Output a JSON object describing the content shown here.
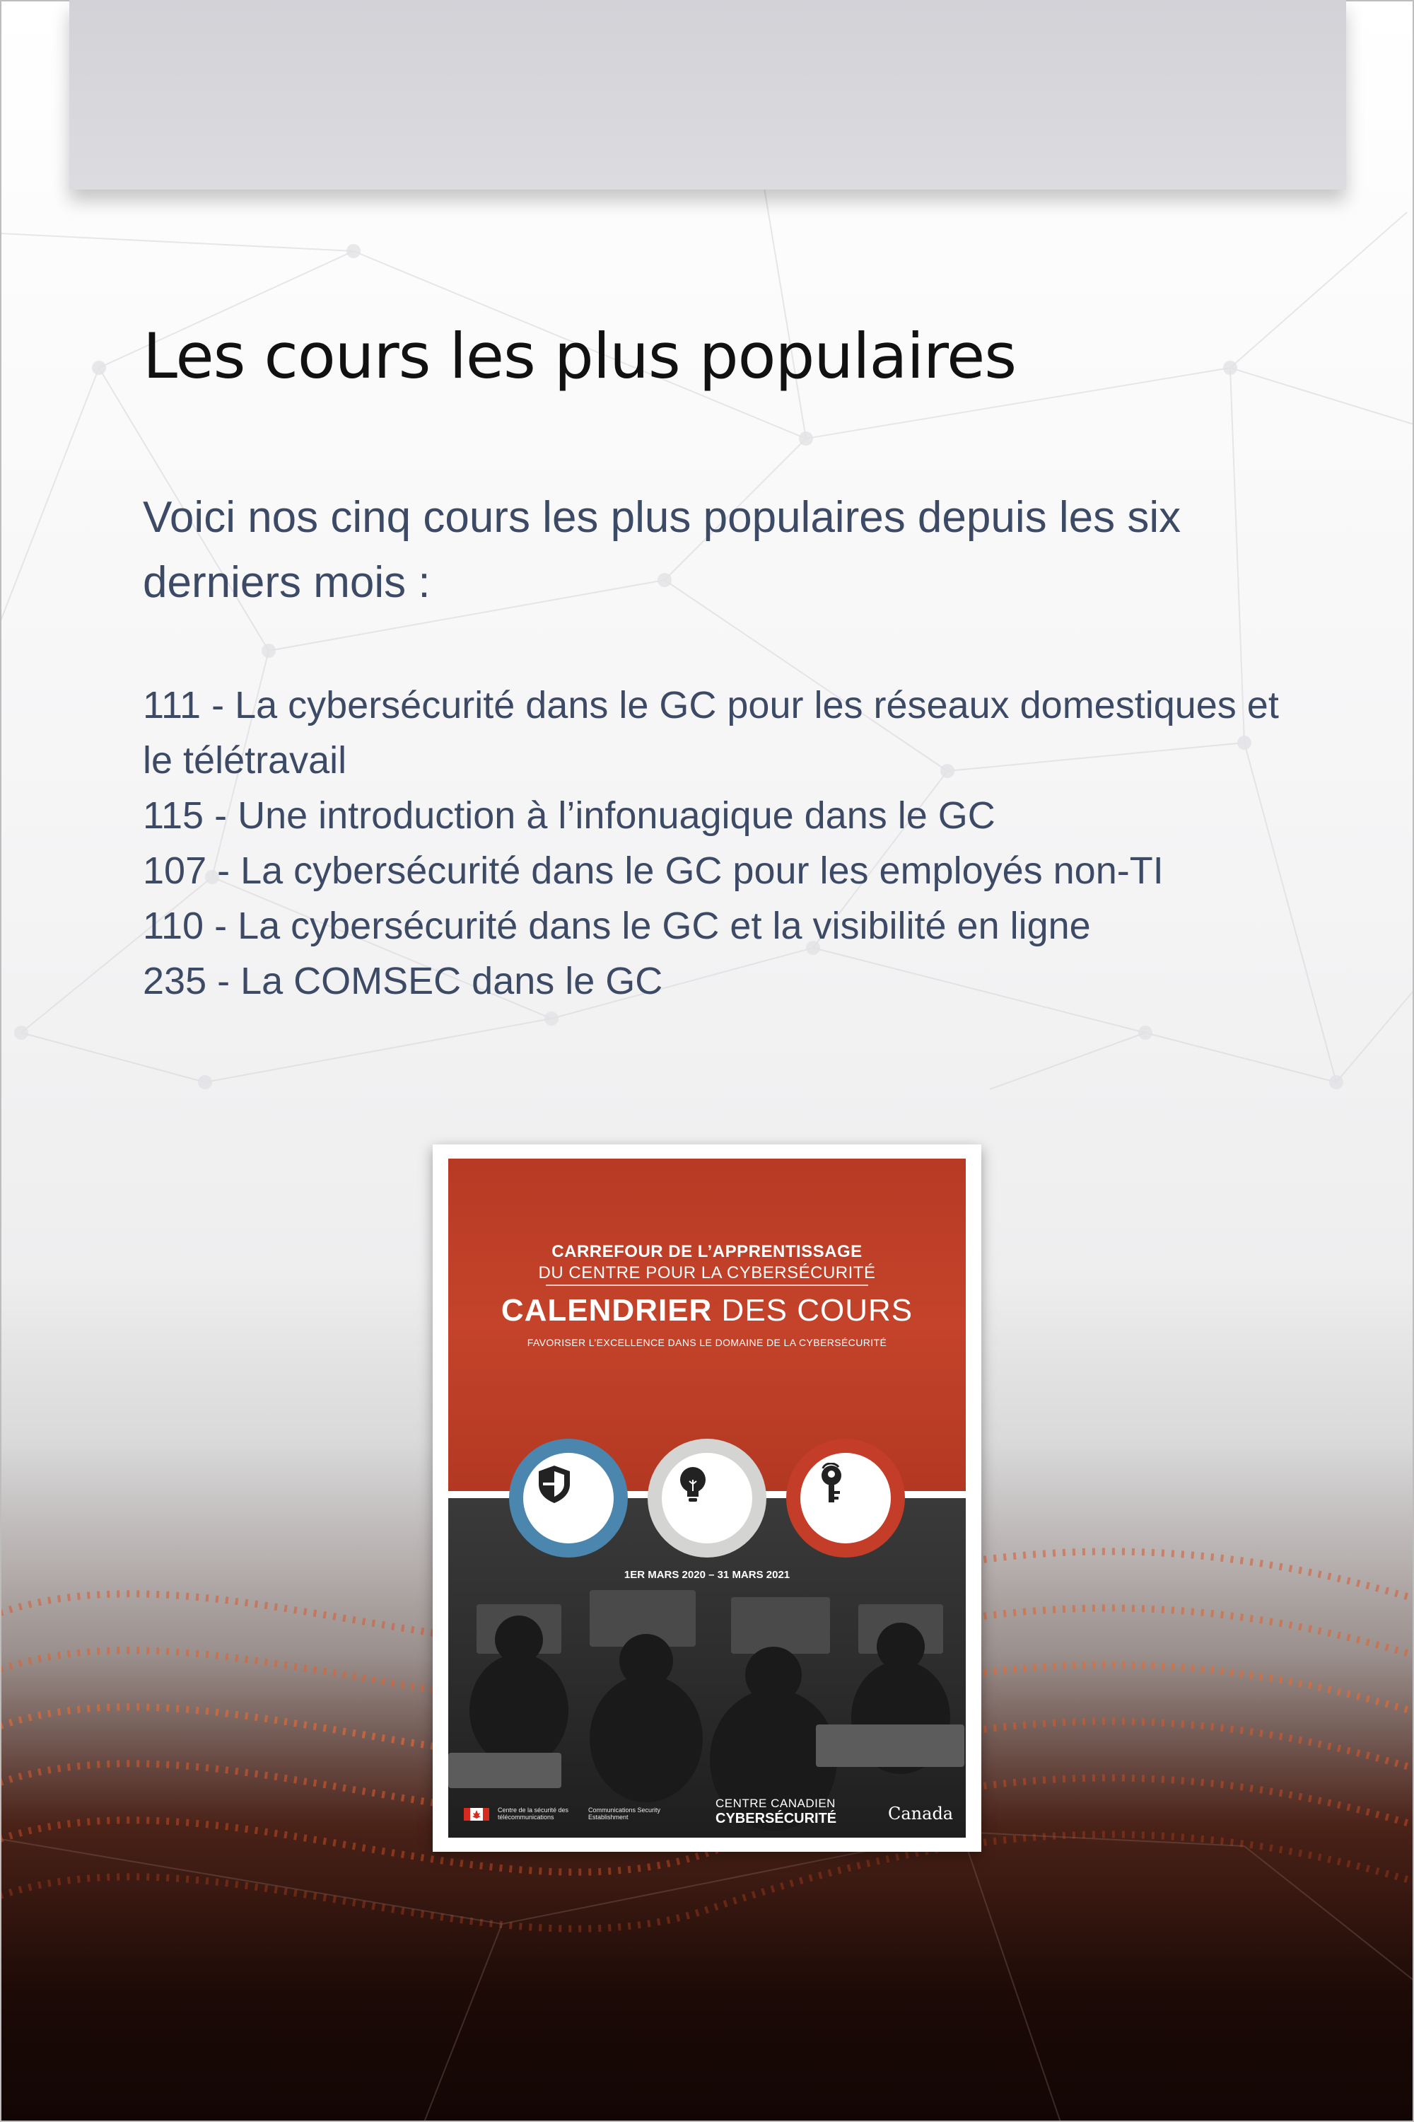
{
  "heading": "Les cours les plus populaires",
  "intro": "Voici nos cinq cours les plus populaires depuis les six derniers mois :",
  "courses": [
    "111 - La cybersécurité dans le GC pour les réseaux domestiques et le télétravail",
    "115 - Une introduction à l’infonuagique dans le GC",
    "107 - La cybersécurité dans le GC pour les employés non-TI",
    "110 - La cybersécurité dans le GC et la visibilité en ligne",
    "235 - La COMSEC dans le GC"
  ],
  "cover": {
    "line1": "CARREFOUR DE L’APPRENTISSAGE",
    "line2": "DU CENTRE POUR LA CYBERSÉCURITÉ",
    "title_bold": "CALENDRIER",
    "title_rest": " DES COURS",
    "tagline": "FAVORISER L’EXCELLENCE DANS LE DOMAINE DE LA CYBERSÉCURITÉ",
    "dates": "1ER MARS 2020 – 31 MARS 2021",
    "footer_cse_fr": "Centre de la sécurité des télécommunications",
    "footer_cse_en": "Communications Security Establishment",
    "centre_line1": "CENTRE CANADIEN",
    "centre_line2": "CYBERSÉCURITÉ",
    "canada_wordmark": "Canada",
    "icons": [
      "shield-icon",
      "lightbulb-icon",
      "key-icon"
    ],
    "colors": {
      "red": "#c4432a",
      "blue": "#4a86ad",
      "grey": "#d4d4d2"
    }
  },
  "colors": {
    "heading": "#111111",
    "body_text": "#3d4a66"
  }
}
